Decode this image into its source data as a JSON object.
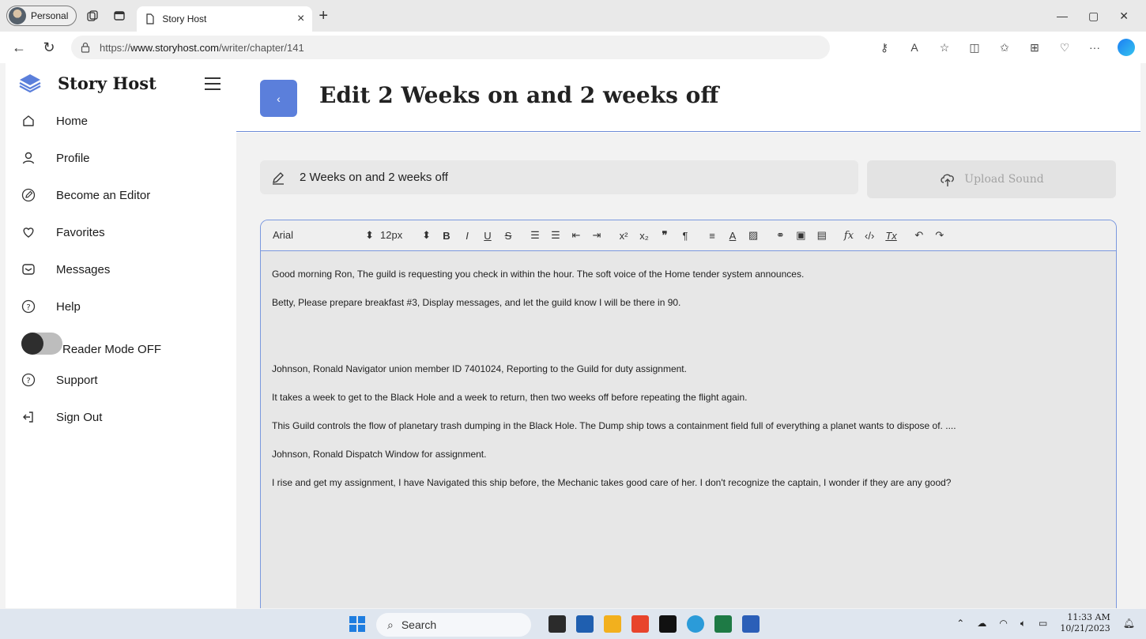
{
  "browser": {
    "profile_label": "Personal",
    "tab_title": "Story Host",
    "url_protocol": "https://",
    "url_host": "www.storyhost.com",
    "url_path": "/writer/chapter/141"
  },
  "sidebar": {
    "brand": "Story Host",
    "items": [
      {
        "label": "Home",
        "icon": "home-icon"
      },
      {
        "label": "Profile",
        "icon": "user-icon"
      },
      {
        "label": "Become an Editor",
        "icon": "edit-icon"
      },
      {
        "label": "Favorites",
        "icon": "heart-icon"
      },
      {
        "label": "Messages",
        "icon": "message-icon"
      },
      {
        "label": "Help",
        "icon": "help-icon"
      },
      {
        "label": "Support",
        "icon": "help-icon"
      },
      {
        "label": "Sign Out",
        "icon": "sign-out-icon"
      }
    ],
    "reader_mode_label": "Reader Mode OFF"
  },
  "main": {
    "back_label": "‹",
    "page_title": "Edit 2 Weeks on and 2 weeks off",
    "chapter_title_value": "2 Weeks on and 2 weeks off",
    "upload_label": "Upload Sound"
  },
  "editor": {
    "font": "Arial",
    "size": "12px",
    "paragraphs": [
      "Good morning Ron, The guild is requesting you check in within the hour. The soft voice of the Home tender system announces.",
      "Betty, Please prepare breakfast #3, Display messages, and let the guild know I will be there in 90.",
      "",
      "Johnson, Ronald Navigator union member ID 7401024, Reporting to the Guild for duty assignment.",
      "It takes a week to get to the Black Hole and a week to return, then two weeks off before repeating the flight again.",
      "This Guild controls the flow of planetary trash dumping in the Black Hole. The Dump ship tows a containment field full of everything a planet wants to dispose of. ....",
      "Johnson, Ronald Dispatch Window for assignment.",
      "I rise and get my assignment, I have Navigated this ship before, the Mechanic takes good care of her. I don't recognize the captain, I wonder if they are any good?"
    ]
  },
  "taskbar": {
    "search_label": "Search",
    "time": "11:33 AM",
    "date": "10/21/2023"
  },
  "colors": {
    "accent": "#5b7fdb",
    "editor_border": "#7a98de"
  }
}
